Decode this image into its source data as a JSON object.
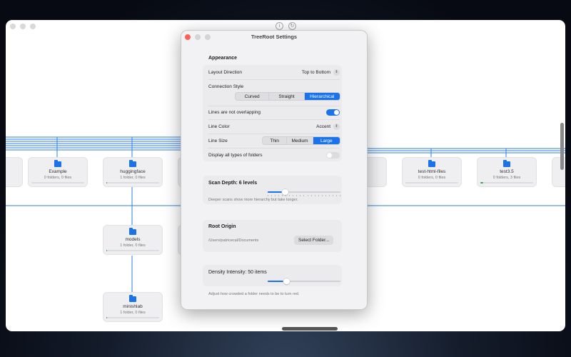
{
  "main_window": {
    "nodes": [
      {
        "name": "Example",
        "count": "0 folders, 0 files",
        "fill": 0
      },
      {
        "name": "huggingface",
        "count": "1 folder, 0 files",
        "fill": 0.02
      },
      {
        "name": "test-html-files",
        "count": "0 folders, 0 files",
        "fill": 0
      },
      {
        "name": "test3.5",
        "count": "0 folders, 3 files",
        "fill": 0.05
      },
      {
        "name": "models",
        "count": "1 folder, 0 files",
        "fill": 0.02
      },
      {
        "name": "minishlab",
        "count": "1 folder, 0 files",
        "fill": 0.02
      }
    ]
  },
  "settings": {
    "title": "TreeRoot Settings",
    "appearance": {
      "heading": "Appearance",
      "layout_direction": {
        "label": "Layout Direction",
        "value": "Top to Bottom"
      },
      "connection_style": {
        "label": "Connection Style",
        "options": [
          "Curved",
          "Straight",
          "Hierarchical"
        ],
        "selected": "Hierarchical"
      },
      "lines_not_overlapping": {
        "label": "Lines are not overlapping",
        "on": true
      },
      "line_color": {
        "label": "Line Color",
        "value": "Accent"
      },
      "line_size": {
        "label": "Line Size",
        "options": [
          "Thin",
          "Medium",
          "Large"
        ],
        "selected": "Large"
      },
      "display_all_folders": {
        "label": "Display all types of folders",
        "on": false
      }
    },
    "scan_depth": {
      "heading": "Scan Depth: 6 levels",
      "value": 6,
      "helper": "Deeper scans show more hierarchy but take longer."
    },
    "root_origin": {
      "heading": "Root Origin",
      "path": "/Users/patricecal/Documents",
      "button": "Select Folder..."
    },
    "density": {
      "heading": "Density Intensity: 50 items",
      "value": 50,
      "helper": "Adjust how crowded a folder needs to be to turn red."
    },
    "colors": {
      "accent": "#1a73e8",
      "close": "#ff5f57"
    }
  }
}
